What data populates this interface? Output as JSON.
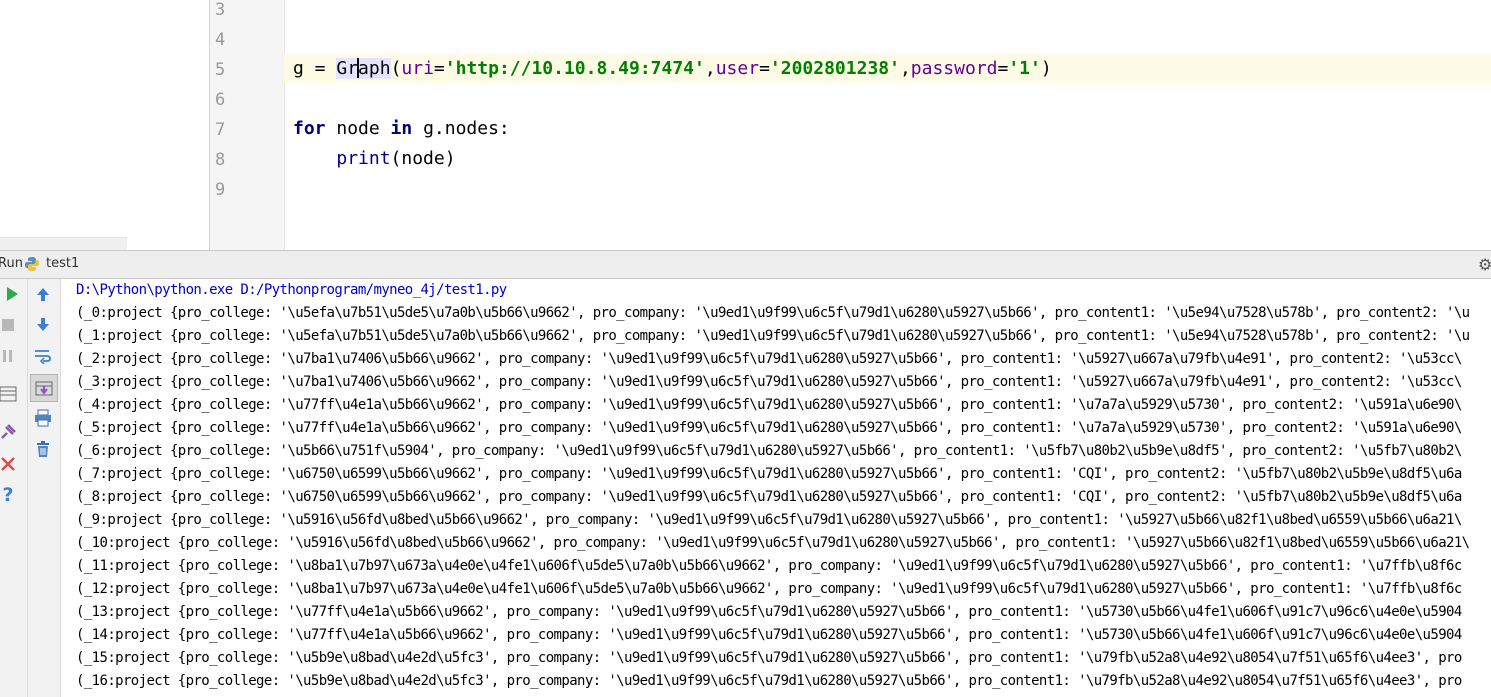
{
  "editor": {
    "line_numbers": [
      "3",
      "4",
      "5",
      "6",
      "7",
      "8",
      "9"
    ],
    "line5": {
      "var": "g",
      "op": " = ",
      "cls_a": "Gr",
      "cls_b": "aph",
      "open": "(",
      "p1": "uri",
      "eq1": "=",
      "v1": "'http://10.10.8.49:7474'",
      "c1": ",",
      "p2": "user",
      "eq2": "=",
      "v2": "'2002801238'",
      "c2": ",",
      "p3": "password",
      "eq3": "=",
      "v3": "'1'",
      "close": ")"
    },
    "line7": {
      "kw_for": "for",
      "mid": " node ",
      "kw_in": "in",
      "rest": " g.nodes:"
    },
    "line8": {
      "indent": "    ",
      "fn": "print",
      "args": "(node)"
    }
  },
  "run_panel": {
    "title": "Run",
    "config_name": "test1",
    "icons": {
      "rerun": "play-icon",
      "stop": "stop-icon",
      "pause": "pause-icon",
      "up": "arrow-up-icon",
      "down": "arrow-down-icon",
      "wrap": "soft-wrap-icon",
      "scroll_end": "scroll-to-end-icon",
      "print": "print-icon",
      "clear": "trash-icon",
      "close": "close-icon",
      "help": "help-icon",
      "settings": "gear-icon"
    }
  },
  "console": {
    "command": "D:\\Python\\python.exe D:/Pythonprogram/myneo_4j/test1.py",
    "lines": [
      "(_0:project {pro_college: '\\u5efa\\u7b51\\u5de5\\u7a0b\\u5b66\\u9662', pro_company: '\\u9ed1\\u9f99\\u6c5f\\u79d1\\u6280\\u5927\\u5b66', pro_content1: '\\u5e94\\u7528\\u578b', pro_content2: '\\u",
      "(_1:project {pro_college: '\\u5efa\\u7b51\\u5de5\\u7a0b\\u5b66\\u9662', pro_company: '\\u9ed1\\u9f99\\u6c5f\\u79d1\\u6280\\u5927\\u5b66', pro_content1: '\\u5e94\\u7528\\u578b', pro_content2: '\\u",
      "(_2:project {pro_college: '\\u7ba1\\u7406\\u5b66\\u9662', pro_company: '\\u9ed1\\u9f99\\u6c5f\\u79d1\\u6280\\u5927\\u5b66', pro_content1: '\\u5927\\u667a\\u79fb\\u4e91', pro_content2: '\\u53cc\\",
      "(_3:project {pro_college: '\\u7ba1\\u7406\\u5b66\\u9662', pro_company: '\\u9ed1\\u9f99\\u6c5f\\u79d1\\u6280\\u5927\\u5b66', pro_content1: '\\u5927\\u667a\\u79fb\\u4e91', pro_content2: '\\u53cc\\",
      "(_4:project {pro_college: '\\u77ff\\u4e1a\\u5b66\\u9662', pro_company: '\\u9ed1\\u9f99\\u6c5f\\u79d1\\u6280\\u5927\\u5b66', pro_content1: '\\u7a7a\\u5929\\u5730', pro_content2: '\\u591a\\u6e90\\",
      "(_5:project {pro_college: '\\u77ff\\u4e1a\\u5b66\\u9662', pro_company: '\\u9ed1\\u9f99\\u6c5f\\u79d1\\u6280\\u5927\\u5b66', pro_content1: '\\u7a7a\\u5929\\u5730', pro_content2: '\\u591a\\u6e90\\",
      "(_6:project {pro_college: '\\u5b66\\u751f\\u5904', pro_company: '\\u9ed1\\u9f99\\u6c5f\\u79d1\\u6280\\u5927\\u5b66', pro_content1: '\\u5fb7\\u80b2\\u5b9e\\u8df5', pro_content2: '\\u5fb7\\u80b2\\",
      "(_7:project {pro_college: '\\u6750\\u6599\\u5b66\\u9662', pro_company: '\\u9ed1\\u9f99\\u6c5f\\u79d1\\u6280\\u5927\\u5b66', pro_content1: 'CQI', pro_content2: '\\u5fb7\\u80b2\\u5b9e\\u8df5\\u6a",
      "(_8:project {pro_college: '\\u6750\\u6599\\u5b66\\u9662', pro_company: '\\u9ed1\\u9f99\\u6c5f\\u79d1\\u6280\\u5927\\u5b66', pro_content1: 'CQI', pro_content2: '\\u5fb7\\u80b2\\u5b9e\\u8df5\\u6a",
      "(_9:project {pro_college: '\\u5916\\u56fd\\u8bed\\u5b66\\u9662', pro_company: '\\u9ed1\\u9f99\\u6c5f\\u79d1\\u6280\\u5927\\u5b66', pro_content1: '\\u5927\\u5b66\\u82f1\\u8bed\\u6559\\u5b66\\u6a21\\",
      "(_10:project {pro_college: '\\u5916\\u56fd\\u8bed\\u5b66\\u9662', pro_company: '\\u9ed1\\u9f99\\u6c5f\\u79d1\\u6280\\u5927\\u5b66', pro_content1: '\\u5927\\u5b66\\u82f1\\u8bed\\u6559\\u5b66\\u6a21\\",
      "(_11:project {pro_college: '\\u8ba1\\u7b97\\u673a\\u4e0e\\u4fe1\\u606f\\u5de5\\u7a0b\\u5b66\\u9662', pro_company: '\\u9ed1\\u9f99\\u6c5f\\u79d1\\u6280\\u5927\\u5b66', pro_content1: '\\u7ffb\\u8f6c",
      "(_12:project {pro_college: '\\u8ba1\\u7b97\\u673a\\u4e0e\\u4fe1\\u606f\\u5de5\\u7a0b\\u5b66\\u9662', pro_company: '\\u9ed1\\u9f99\\u6c5f\\u79d1\\u6280\\u5927\\u5b66', pro_content1: '\\u7ffb\\u8f6c",
      "(_13:project {pro_college: '\\u77ff\\u4e1a\\u5b66\\u9662', pro_company: '\\u9ed1\\u9f99\\u6c5f\\u79d1\\u6280\\u5927\\u5b66', pro_content1: '\\u5730\\u5b66\\u4fe1\\u606f\\u91c7\\u96c6\\u4e0e\\u5904",
      "(_14:project {pro_college: '\\u77ff\\u4e1a\\u5b66\\u9662', pro_company: '\\u9ed1\\u9f99\\u6c5f\\u79d1\\u6280\\u5927\\u5b66', pro_content1: '\\u5730\\u5b66\\u4fe1\\u606f\\u91c7\\u96c6\\u4e0e\\u5904",
      "(_15:project {pro_college: '\\u5b9e\\u8bad\\u4e2d\\u5fc3', pro_company: '\\u9ed1\\u9f99\\u6c5f\\u79d1\\u6280\\u5927\\u5b66', pro_content1: '\\u79fb\\u52a8\\u4e92\\u8054\\u7f51\\u65f6\\u4ee3', pro",
      "(_16:project {pro_college: '\\u5b9e\\u8bad\\u4e2d\\u5fc3', pro_company: '\\u9ed1\\u9f99\\u6c5f\\u79d1\\u6280\\u5927\\u5b66', pro_content1: '\\u79fb\\u52a8\\u4e92\\u8054\\u7f51\\u65f6\\u4ee3', pro"
    ]
  },
  "colors": {
    "keyword": "#000080",
    "string": "#008000",
    "parameter": "#660099",
    "command": "#0000c8",
    "current_line": "#fdfbe6"
  }
}
